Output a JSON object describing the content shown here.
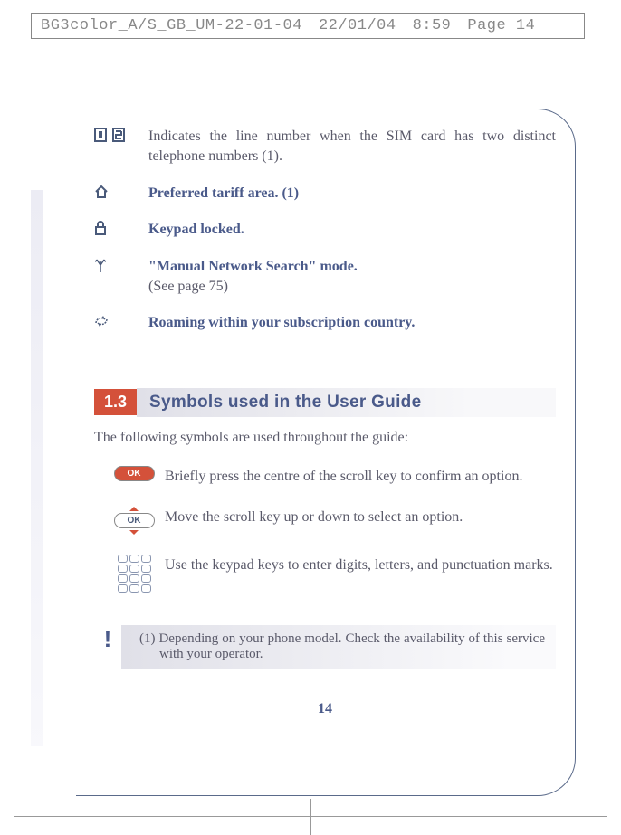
{
  "print_header": {
    "file": "BG3color_A/S_GB_UM-22-01-04",
    "date": "22/01/04",
    "time": "8:59",
    "page": "Page 14"
  },
  "icon_rows": [
    {
      "icon_name": "line-1-2-icon",
      "text": "Indicates the line number when the SIM card has two distinct telephone numbers (1).",
      "bold": false
    },
    {
      "icon_name": "house-icon",
      "text": "Preferred tariff area. (1)",
      "bold": true
    },
    {
      "icon_name": "lock-icon",
      "text": "Keypad locked.",
      "bold": true
    },
    {
      "icon_name": "antenna-icon",
      "text_bold": "\"Manual Network Search\" mode.",
      "text_plain": "(See page 75)"
    },
    {
      "icon_name": "roaming-icon",
      "text": "Roaming within your subscription country.",
      "bold": true
    }
  ],
  "section": {
    "num": "1.3",
    "title": "Symbols used in the User Guide",
    "intro": "The following symbols are used throughout the guide:"
  },
  "symbols": [
    {
      "name": "ok-press",
      "text": "Briefly press the centre of the scroll key to confirm an option."
    },
    {
      "name": "ok-scroll",
      "text": "Move the scroll key up or down to select an option."
    },
    {
      "name": "keypad",
      "text": "Use the keypad keys to enter digits, letters, and punctuation marks."
    }
  ],
  "footnote": "(1) Depending on your phone model. Check the availability of this service with your operator.",
  "page_number": "14"
}
